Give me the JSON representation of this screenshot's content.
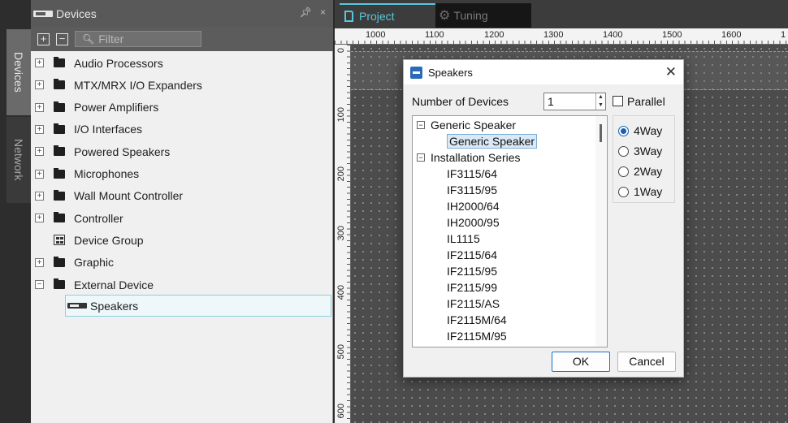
{
  "left_tabs": [
    "Devices",
    "Network"
  ],
  "devices_panel": {
    "title": "Devices",
    "pin_icon": "pin-icon",
    "close_label": "×",
    "toolbar": {
      "expand": "+",
      "collapse": "−",
      "filter_placeholder": "Filter"
    },
    "items": [
      {
        "label": "Audio Processors",
        "icon": "folder-icon",
        "expander": "+"
      },
      {
        "label": "MTX/MRX I/O Expanders",
        "icon": "folder-icon",
        "expander": "+"
      },
      {
        "label": "Power Amplifiers",
        "icon": "folder-icon",
        "expander": "+"
      },
      {
        "label": "I/O Interfaces",
        "icon": "folder-icon",
        "expander": "+"
      },
      {
        "label": "Powered Speakers",
        "icon": "folder-icon",
        "expander": "+"
      },
      {
        "label": "Microphones",
        "icon": "folder-icon",
        "expander": "+"
      },
      {
        "label": "Wall Mount Controller",
        "icon": "folder-icon",
        "expander": "+"
      },
      {
        "label": "Controller",
        "icon": "folder-icon",
        "expander": "+"
      },
      {
        "label": "Device Group",
        "icon": "device-group-icon",
        "expander": ""
      },
      {
        "label": "Graphic",
        "icon": "folder-icon",
        "expander": "+"
      },
      {
        "label": "External Device",
        "icon": "folder-icon",
        "expander": "−"
      }
    ],
    "child_item": {
      "label": "Speakers",
      "icon": "speaker-device-icon"
    }
  },
  "workspace": {
    "tabs": [
      {
        "label": "Project",
        "active": true
      },
      {
        "label": "Tuning",
        "active": false
      }
    ],
    "hruler": [
      "1000",
      "1100",
      "1200",
      "1300",
      "1400",
      "1500",
      "1600",
      "1"
    ],
    "vruler": [
      "0",
      "100",
      "200",
      "300",
      "400",
      "500",
      "600"
    ]
  },
  "dialog": {
    "title": "Speakers",
    "close_label": "✕",
    "number_label": "Number of Devices",
    "number_value": "1",
    "parallel_label": "Parallel",
    "parallel_checked": false,
    "tree": [
      {
        "label": "Generic Speaker",
        "level": 0,
        "expander": "−"
      },
      {
        "label": "Generic Speaker",
        "level": 1,
        "selected": true
      },
      {
        "label": "Installation Series",
        "level": 0,
        "expander": "−"
      },
      {
        "label": "IF3115/64",
        "level": 1
      },
      {
        "label": "IF3115/95",
        "level": 1
      },
      {
        "label": "IH2000/64",
        "level": 1
      },
      {
        "label": "IH2000/95",
        "level": 1
      },
      {
        "label": "IL1115",
        "level": 1
      },
      {
        "label": "IF2115/64",
        "level": 1
      },
      {
        "label": "IF2115/95",
        "level": 1
      },
      {
        "label": "IF2115/99",
        "level": 1
      },
      {
        "label": "IF2115/AS",
        "level": 1
      },
      {
        "label": "IF2115M/64",
        "level": 1
      },
      {
        "label": "IF2115M/95",
        "level": 1
      }
    ],
    "ways": [
      {
        "label": "4Way",
        "selected": true
      },
      {
        "label": "3Way",
        "selected": false
      },
      {
        "label": "2Way",
        "selected": false
      },
      {
        "label": "1Way",
        "selected": false
      }
    ],
    "ok_label": "OK",
    "cancel_label": "Cancel"
  },
  "colors": {
    "accent": "#58c8dc",
    "selection_border": "#8fd0e0",
    "radio_accent": "#1a5fb4"
  }
}
